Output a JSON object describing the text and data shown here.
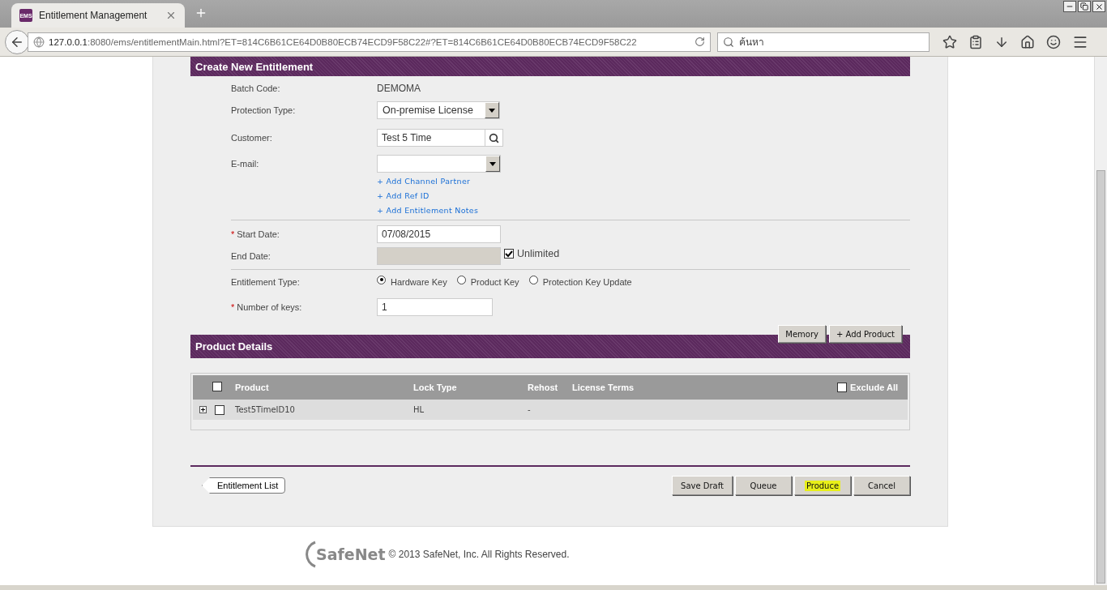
{
  "window": {
    "tab_title": "Entitlement Management",
    "favicon": "EMS"
  },
  "address_bar": {
    "host": "127.0.0.1",
    "rest": ":8080/ems/entitlementMain.html?ET=814C6B61CE64D0B80ECB74ECD9F58C22#?ET=814C6B61CE64D0B80ECB74ECD9F58C22"
  },
  "search": {
    "placeholder": "ค้นหา"
  },
  "form": {
    "title": "Create New Entitlement",
    "batch_code": {
      "label": "Batch Code:",
      "value": "DEMOMA"
    },
    "protection_type": {
      "label": "Protection Type:",
      "value": "On-premise License"
    },
    "customer": {
      "label": "Customer:",
      "value": "Test 5 Time"
    },
    "email": {
      "label": "E-mail:"
    },
    "links": [
      "+ Add Channel Partner",
      "+ Add Ref ID",
      "+ Add Entitlement Notes"
    ],
    "start_date": {
      "marker": "*",
      "label": "Start Date:",
      "value": "07/08/2015"
    },
    "end_date": {
      "label": "End Date:",
      "disabled": true,
      "unlimited": {
        "label": "Unlimited",
        "checked": true
      }
    },
    "entitlement_type": {
      "label": "Entitlement Type:",
      "options": [
        {
          "label": "Hardware Key",
          "selected": true
        },
        {
          "label": "Product Key",
          "selected": false
        },
        {
          "label": "Protection Key Update",
          "selected": false
        }
      ]
    },
    "number_of_keys": {
      "marker": "*",
      "label": "Number of keys:",
      "value": "1"
    }
  },
  "product_details": {
    "title": "Product Details",
    "buttons": [
      "Memory",
      "+ Add Product"
    ],
    "select_all_checked": false,
    "columns": [
      "Product",
      "Lock Type",
      "Rehost",
      "License Terms"
    ],
    "exclude_all": {
      "label": "Exclude All",
      "checked": false
    },
    "rows": [
      {
        "product": "Test5TimeID10",
        "lock_type": "HL",
        "rehost": "-",
        "checked": false
      }
    ]
  },
  "footer_actions": {
    "back": "Entitlement List",
    "buttons": [
      {
        "label": "Save Draft",
        "highlighted": false
      },
      {
        "label": "Queue",
        "highlighted": false
      },
      {
        "label": "Produce",
        "highlighted": true
      },
      {
        "label": "Cancel",
        "highlighted": false
      }
    ]
  },
  "copyright": {
    "logo": "SafeNet",
    "text": "© 2013 SafeNet, Inc. All Rights Reserved."
  }
}
